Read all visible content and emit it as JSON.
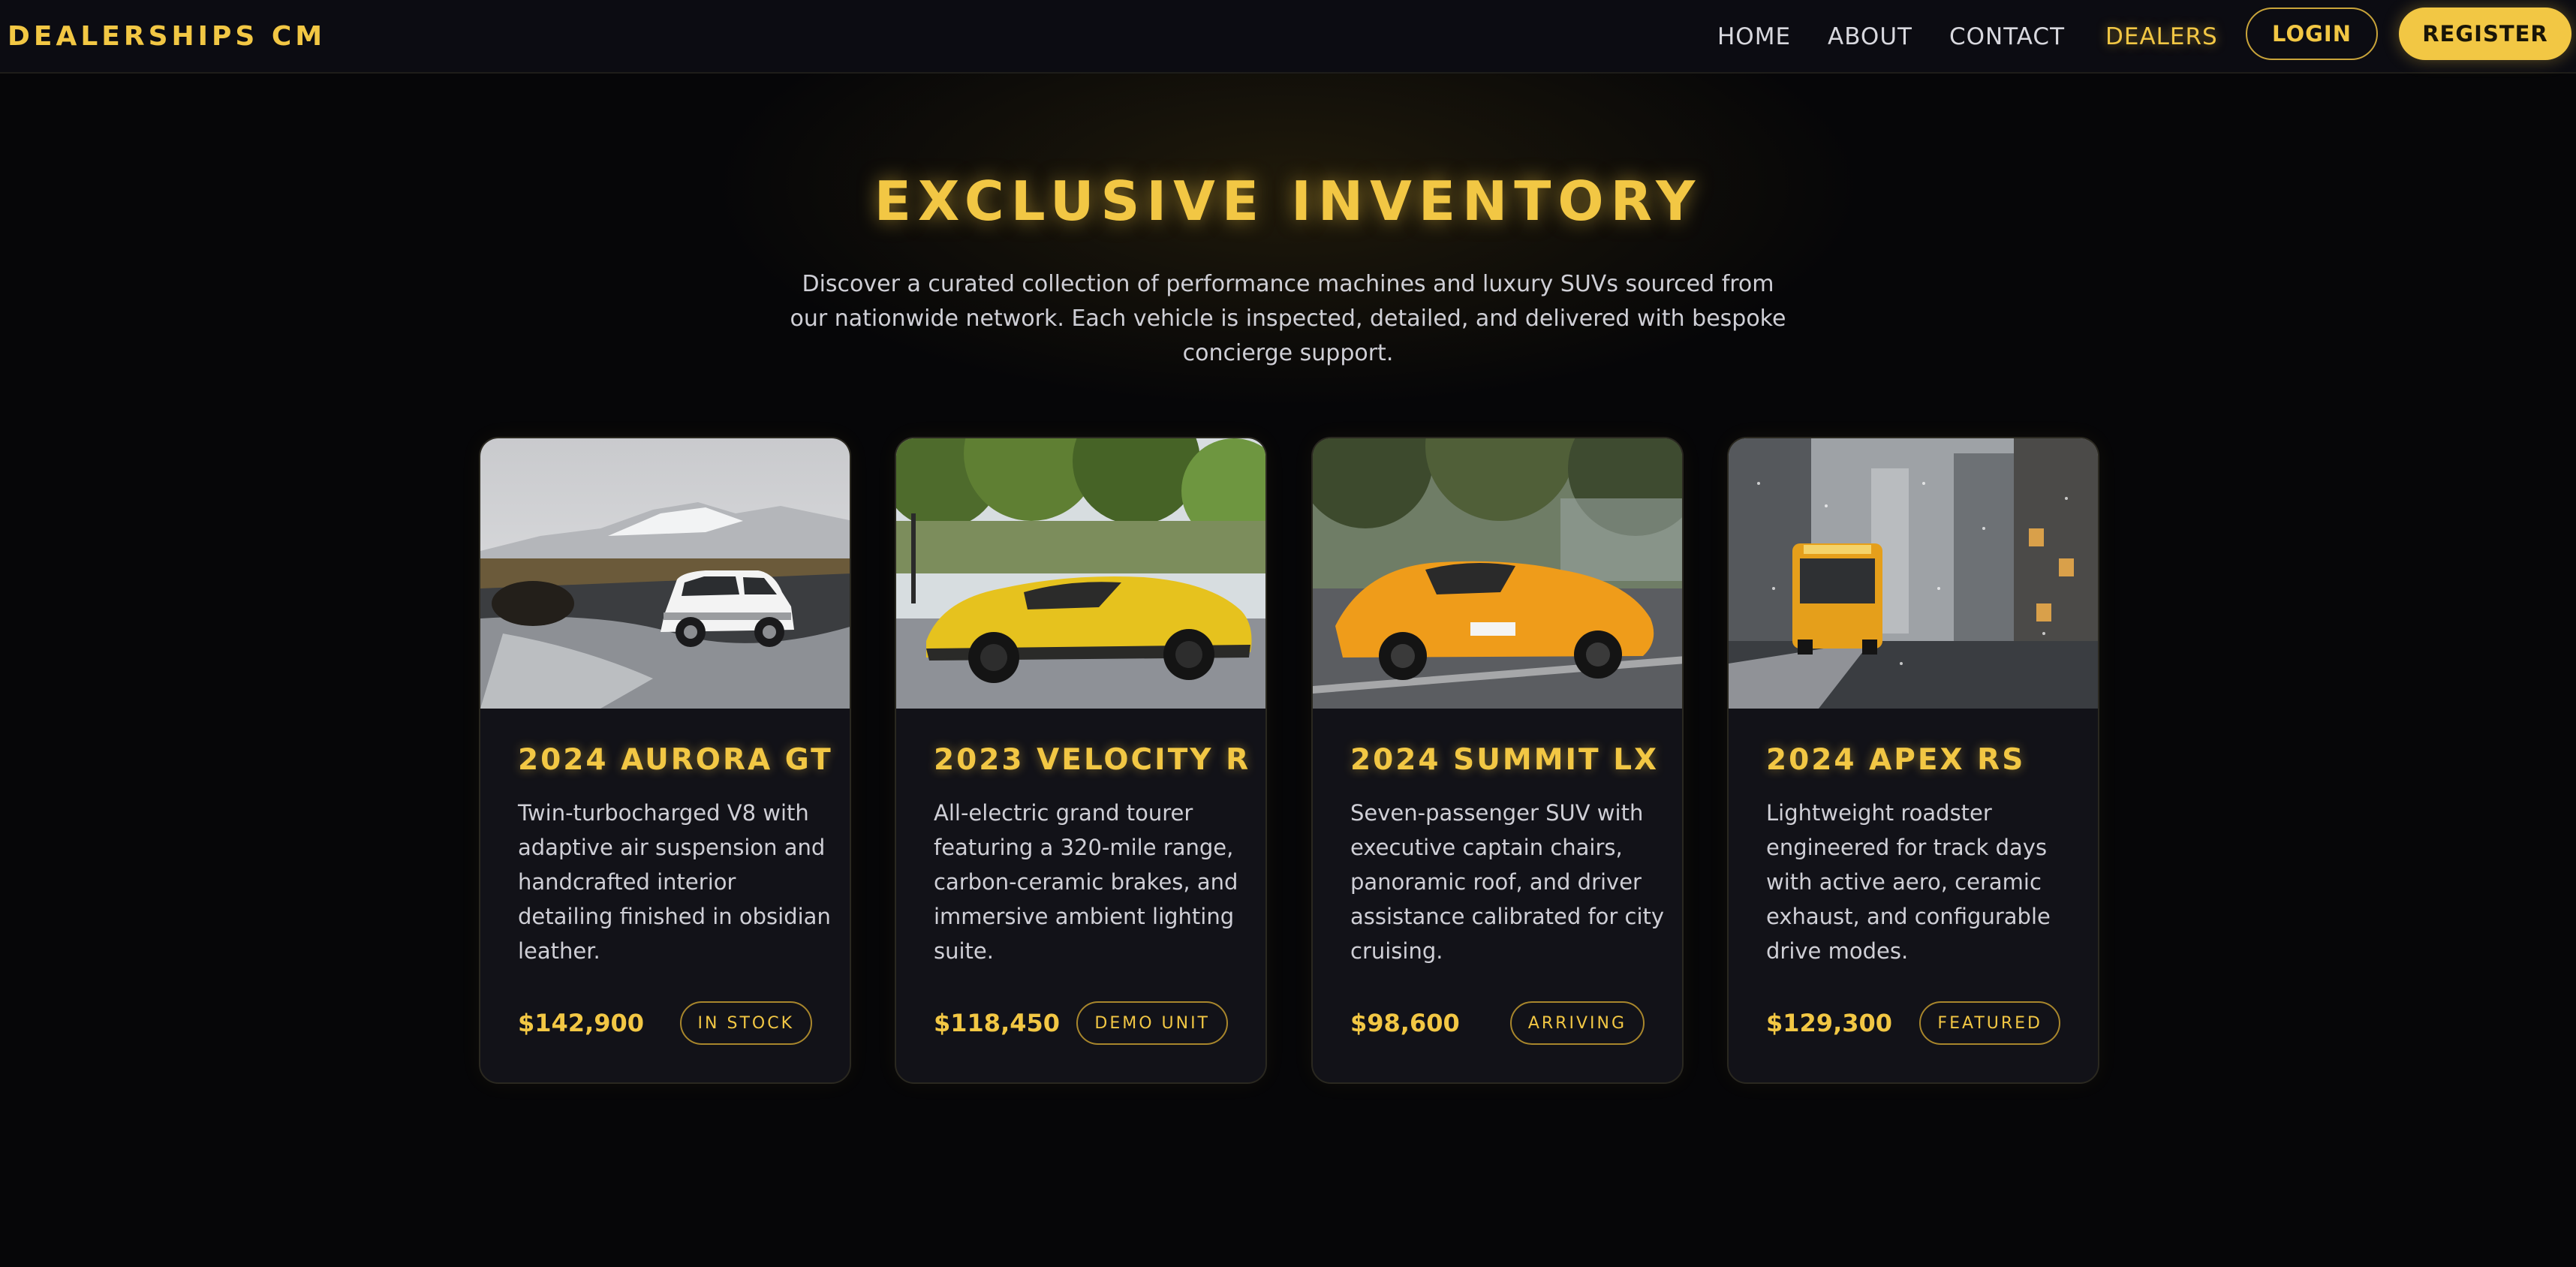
{
  "nav": {
    "brand": "DEALERSHIPS CM",
    "links": [
      {
        "label": "HOME",
        "active": false
      },
      {
        "label": "ABOUT",
        "active": false
      },
      {
        "label": "CONTACT",
        "active": false
      },
      {
        "label": "DEALERS",
        "active": true
      }
    ],
    "login_label": "LOGIN",
    "register_label": "REGISTER"
  },
  "hero": {
    "title": "EXCLUSIVE INVENTORY",
    "description": "Discover a curated collection of performance machines and luxury SUVs sourced from our nationwide network. Each vehicle is inspected, detailed, and delivered with bespoke concierge support."
  },
  "cards": [
    {
      "title": "2024 AURORA GT",
      "description": "Twin-turbocharged V8 with adaptive air suspension and handcrafted interior detailing finished in obsidian leather.",
      "price": "$142,900",
      "badge": "IN STOCK",
      "image": "white-suv-on-icy-landscape"
    },
    {
      "title": "2023 VELOCITY R",
      "description": "All-electric grand tourer featuring a 320-mile range, carbon-ceramic brakes, and immersive ambient lighting suite.",
      "price": "$118,450",
      "badge": "DEMO UNIT",
      "image": "yellow-supercar-under-trees"
    },
    {
      "title": "2024 SUMMIT LX",
      "description": "Seven-passenger SUV with executive captain chairs, panoramic roof, and driver assistance calibrated for city cruising.",
      "price": "$98,600",
      "badge": "ARRIVING",
      "image": "orange-race-car-on-road"
    },
    {
      "title": "2024 APEX RS",
      "description": "Lightweight roadster engineered for track days with active aero, ceramic exhaust, and configurable drive modes.",
      "price": "$129,300",
      "badge": "FEATURED",
      "image": "bus-on-snowy-city-street"
    }
  ],
  "colors": {
    "accent": "#f2c744",
    "background": "#060608",
    "card": "#121218",
    "text": "#cfcfd6"
  }
}
